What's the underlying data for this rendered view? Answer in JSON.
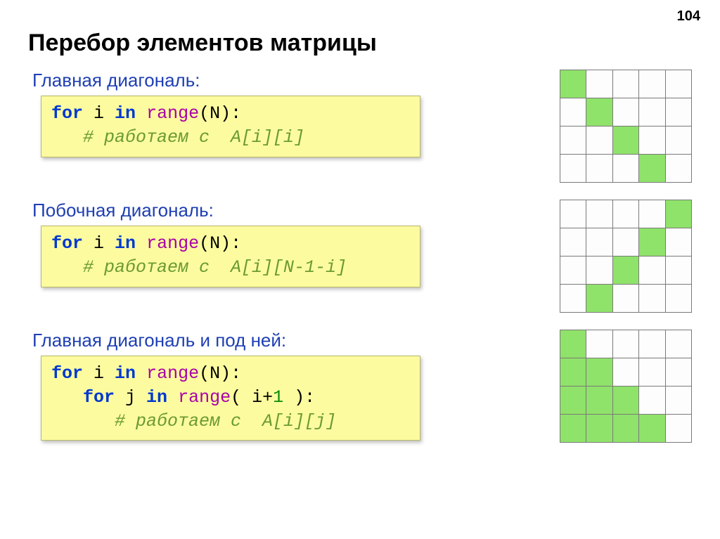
{
  "page_number": "104",
  "title": "Перебор элементов матрицы",
  "sections": [
    {
      "heading": "Главная диагональ:",
      "code": {
        "l1": {
          "kw": "for",
          "mid": " i ",
          "in": "in",
          "sp": " ",
          "fn": "range",
          "lp": "(",
          "arg": "N",
          "rp": "):"
        },
        "l2_indent": "   ",
        "l2_comment": "# работаем с  A[i][i]"
      },
      "grid_rows": 4,
      "grid_cols": 5,
      "filled": [
        [
          0,
          0
        ],
        [
          1,
          1
        ],
        [
          2,
          2
        ],
        [
          3,
          3
        ]
      ]
    },
    {
      "heading": "Побочная диагональ:",
      "code": {
        "l1": {
          "kw": "for",
          "mid": " i ",
          "in": "in",
          "sp": " ",
          "fn": "range",
          "lp": "(",
          "arg": "N",
          "rp": "):"
        },
        "l2_indent": "   ",
        "l2_comment": "# работаем с  A[i][N-1-i]"
      },
      "grid_rows": 4,
      "grid_cols": 5,
      "filled": [
        [
          0,
          4
        ],
        [
          1,
          3
        ],
        [
          2,
          2
        ],
        [
          3,
          1
        ]
      ]
    },
    {
      "heading": "Главная диагональ и под ней:",
      "code3": {
        "l1": {
          "kw": "for",
          "mid": " i ",
          "in": "in",
          "sp": " ",
          "fn": "range",
          "lp": "(",
          "arg": "N",
          "rp": "):"
        },
        "l2_indent": "   ",
        "l2": {
          "kw": "for",
          "mid": " j ",
          "in": "in",
          "sp": " ",
          "fn": "range",
          "lp": "(",
          "pre": " i+",
          "num": "1",
          "post": " ",
          "rp": "):"
        },
        "l3_indent": "      ",
        "l3_comment": "# работаем с  A[i][j]"
      },
      "grid_rows": 4,
      "grid_cols": 5,
      "filled": [
        [
          0,
          0
        ],
        [
          1,
          0
        ],
        [
          1,
          1
        ],
        [
          2,
          0
        ],
        [
          2,
          1
        ],
        [
          2,
          2
        ],
        [
          3,
          0
        ],
        [
          3,
          1
        ],
        [
          3,
          2
        ],
        [
          3,
          3
        ]
      ]
    }
  ]
}
